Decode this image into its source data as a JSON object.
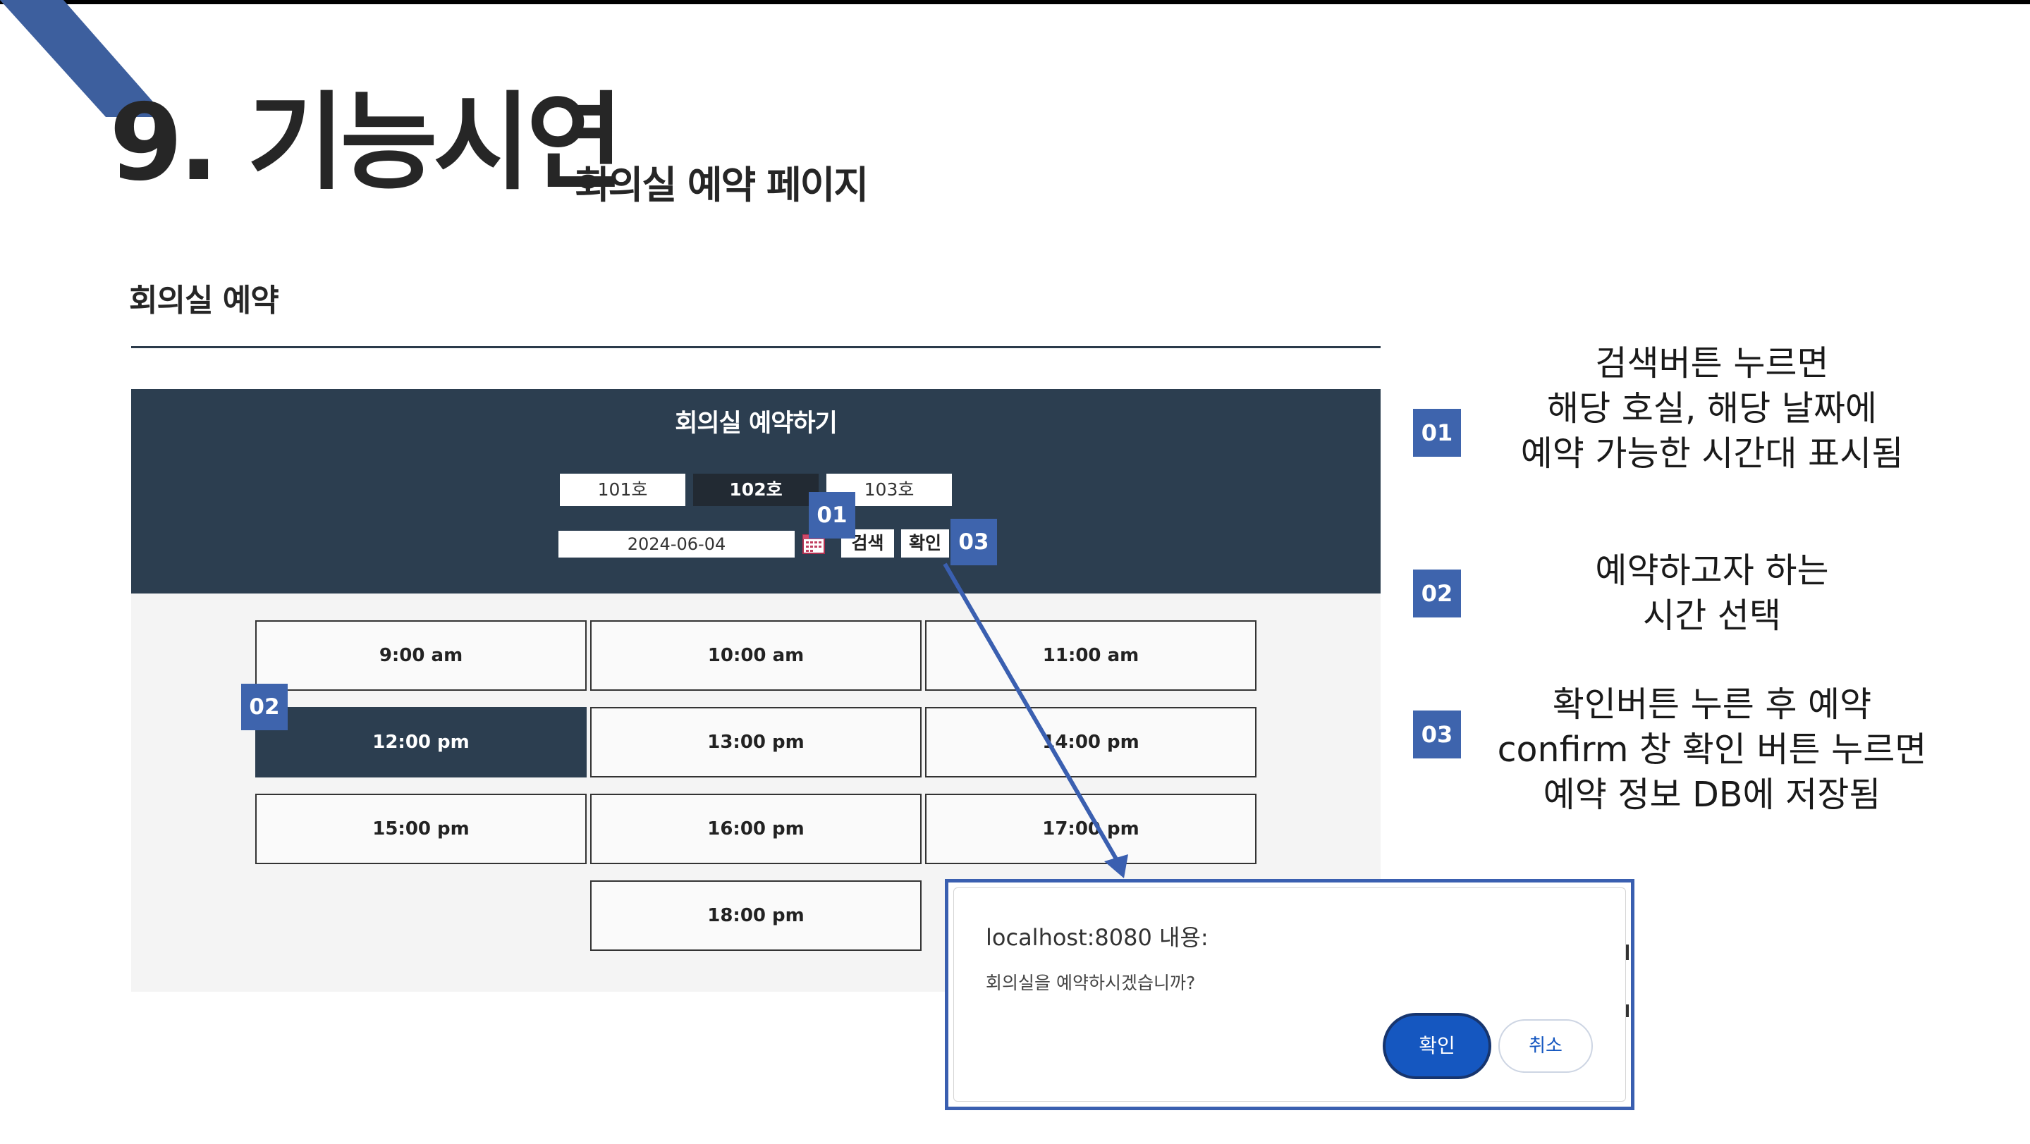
{
  "slide": {
    "title": "9. 기능시연",
    "subtitle": "회의실 예약 페이지",
    "section_heading": "회의실 예약"
  },
  "app": {
    "title": "회의실 예약하기",
    "rooms": [
      {
        "label": "101호",
        "selected": false
      },
      {
        "label": "102호",
        "selected": true
      },
      {
        "label": "103호",
        "selected": false
      }
    ],
    "date_value": "2024-06-04",
    "search_label": "검색",
    "confirm_label": "확인",
    "time_slots": [
      {
        "label": "9:00 am",
        "selected": false
      },
      {
        "label": "10:00 am",
        "selected": false
      },
      {
        "label": "11:00 am",
        "selected": false
      },
      {
        "label": "12:00 pm",
        "selected": true
      },
      {
        "label": "13:00 pm",
        "selected": false
      },
      {
        "label": "14:00 pm",
        "selected": false
      },
      {
        "label": "15:00 pm",
        "selected": false
      },
      {
        "label": "16:00 pm",
        "selected": false
      },
      {
        "label": "17:00 pm",
        "selected": false
      },
      {
        "label": "18:00 pm",
        "selected": false
      }
    ]
  },
  "markers": {
    "m01": "01",
    "m02": "02",
    "m03": "03"
  },
  "dialog": {
    "origin": "localhost:8080 내용:",
    "message": "회의실을 예약하시겠습니까?",
    "ok_label": "확인",
    "cancel_label": "취소"
  },
  "descriptions": [
    {
      "badge": "01",
      "lines": [
        "검색버튼 누르면",
        "해당 호실, 해당 날짜에",
        "예약 가능한 시간대 표시됨"
      ]
    },
    {
      "badge": "02",
      "lines": [
        "예약하고자 하는",
        "시간 선택"
      ]
    },
    {
      "badge": "03",
      "lines": [
        "확인버튼 누른 후 예약",
        "confirm 창 확인 버튼 누르면",
        "예약 정보 DB에 저장됨"
      ]
    }
  ],
  "colors": {
    "header_bg": "#2c3e50",
    "badge": "#3e64ad",
    "accent_blue": "#1557c0",
    "corner_stripe": "#3d5f9e"
  }
}
